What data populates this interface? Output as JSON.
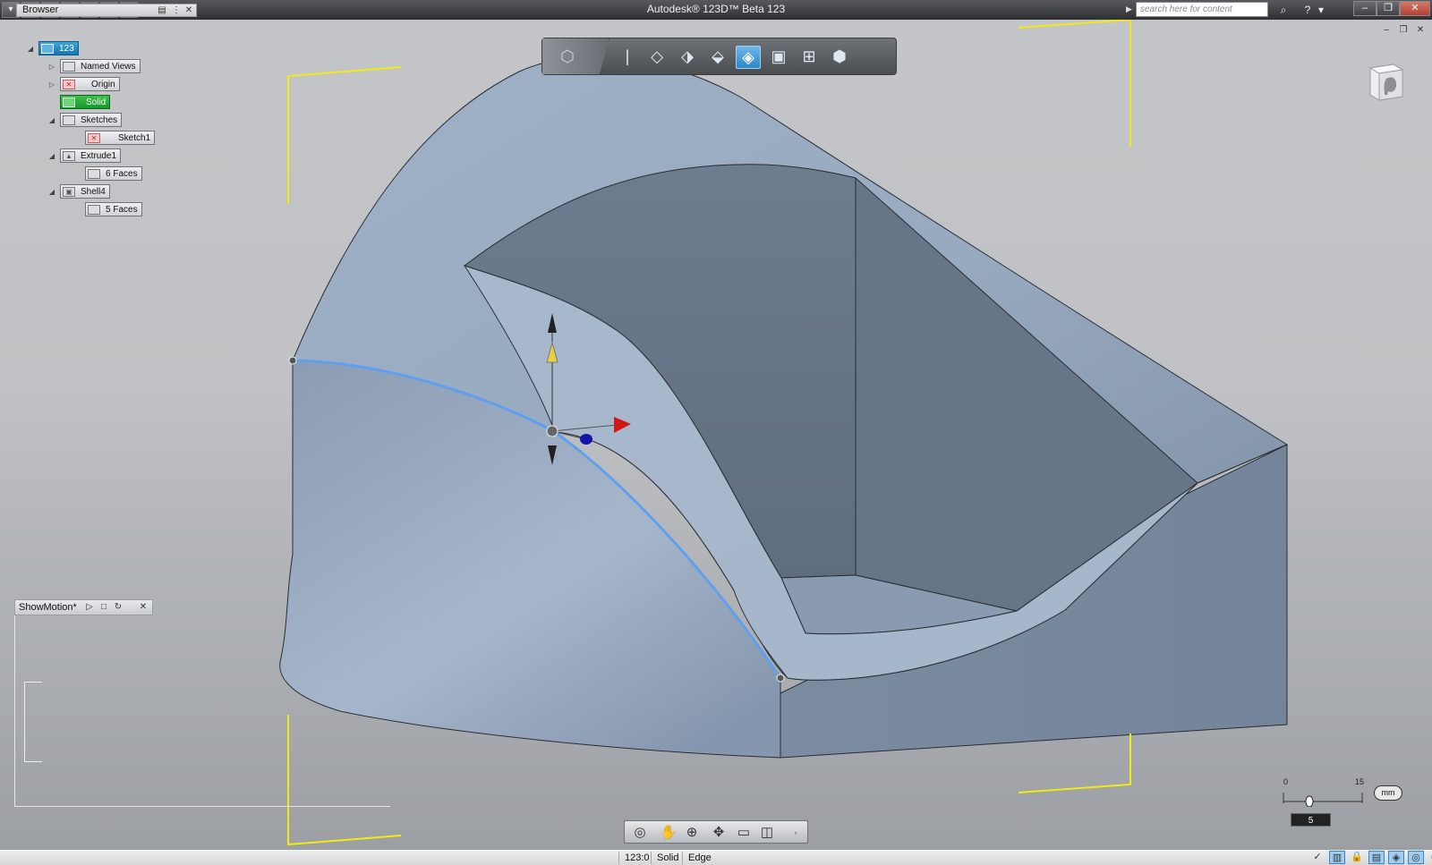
{
  "titlebar": {
    "app_title": "Autodesk® 123D™ Beta   123",
    "quick_access": [
      "1",
      "2",
      "3",
      "4",
      "5"
    ],
    "search_placeholder": "search here for content",
    "buttons": {
      "minimize": "–",
      "restore": "❐",
      "close": "✕"
    }
  },
  "browser": {
    "title": "Browser",
    "items": [
      {
        "label": "123",
        "expander": "◢"
      },
      {
        "label": "Named Views",
        "expander": "▷"
      },
      {
        "label": "Origin",
        "expander": "▷"
      },
      {
        "label": "Solid",
        "expander": ""
      },
      {
        "label": "Sketches",
        "expander": "◢"
      },
      {
        "label": "Sketch1",
        "expander": ""
      },
      {
        "label": "Extrude1",
        "expander": "◢"
      },
      {
        "label": "6 Faces",
        "expander": ""
      },
      {
        "label": "Shell4",
        "expander": "◢"
      },
      {
        "label": "5 Faces",
        "expander": ""
      }
    ]
  },
  "viewport_window_buttons": {
    "minimize": "–",
    "restore": "❐",
    "close": "✕"
  },
  "showmotion": {
    "title": "ShowMotion*"
  },
  "scale": {
    "min": "0",
    "max": "15",
    "unit": "mm",
    "value": "5"
  },
  "statusbar": {
    "cells": [
      "123:0",
      "Solid",
      "Edge"
    ]
  },
  "colors": {
    "selection_blue": "#1577b6",
    "selection_green": "#17982a",
    "model_face": "#8fa3bd",
    "model_inner": "#6a7a8d",
    "edge_highlight": "#5f9ff0",
    "bounds_yellow": "#f2ea14"
  }
}
